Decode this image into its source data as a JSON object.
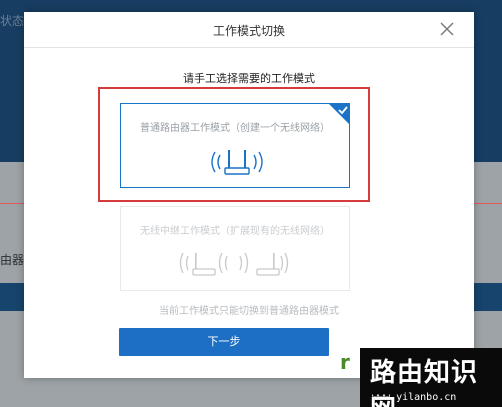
{
  "background": {
    "status_text": "状态",
    "router_text": "由器"
  },
  "modal": {
    "title": "工作模式切换",
    "instruction": "请手工选择需要的工作模式",
    "modes": [
      {
        "label": "普通路由器工作模式（创建一个无线网络）",
        "selected": true
      },
      {
        "label": "无线中继工作模式（扩展现有的无线网络）",
        "selected": false,
        "disabled": true
      }
    ],
    "note": "当前工作模式只能切换到普通路由器模式",
    "next_button": "下一步"
  },
  "watermark": {
    "title": "路由知识网",
    "url": "www.yilanbo.cn",
    "logo": "r"
  },
  "colors": {
    "primary": "#1c6fc4",
    "highlight": "#d63b3b",
    "selected_border": "#1a73c7"
  }
}
